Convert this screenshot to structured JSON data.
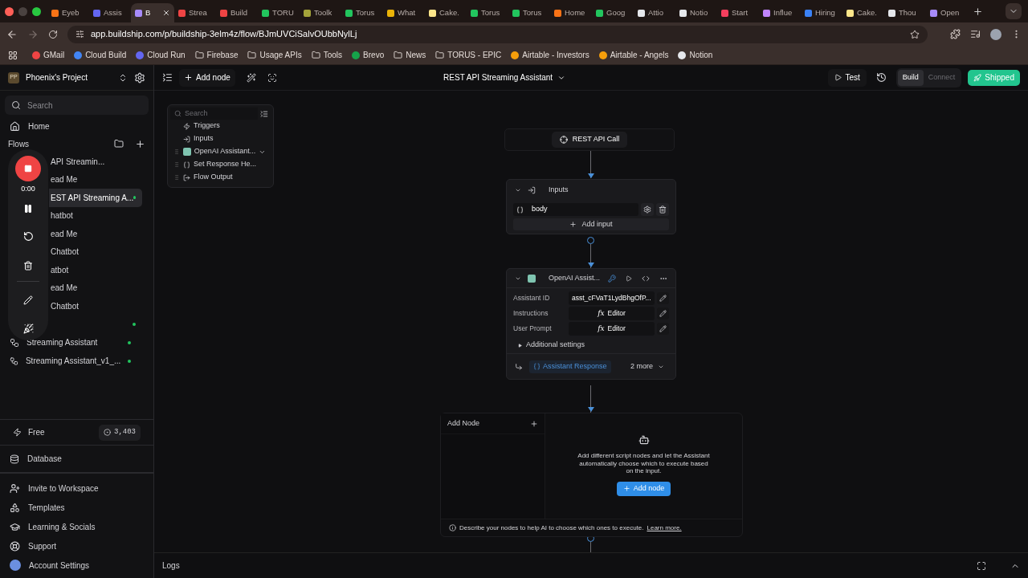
{
  "browser": {
    "tabs": [
      {
        "label": "Eyeb",
        "selected": false,
        "color": "#f97316"
      },
      {
        "label": "Assis",
        "selected": false,
        "color": "#6366f1"
      },
      {
        "label": "B",
        "selected": true,
        "color": "#a78bfa"
      },
      {
        "label": "Strea",
        "selected": false,
        "color": "#ef4444"
      },
      {
        "label": "Build",
        "selected": false,
        "color": "#ef4444"
      },
      {
        "label": "TORU",
        "selected": false,
        "color": "#22c55e"
      },
      {
        "label": "Toolk",
        "selected": false,
        "color": "#a3a33a"
      },
      {
        "label": "Torus",
        "selected": false,
        "color": "#22c55e"
      },
      {
        "label": "What",
        "selected": false,
        "color": "#eab308"
      },
      {
        "label": "Cake.",
        "selected": false,
        "color": "#fde68a"
      },
      {
        "label": "Torus",
        "selected": false,
        "color": "#22c55e"
      },
      {
        "label": "Torus",
        "selected": false,
        "color": "#22c55e"
      },
      {
        "label": "Home",
        "selected": false,
        "color": "#f97316"
      },
      {
        "label": "Goog",
        "selected": false,
        "color": "#22c55e"
      },
      {
        "label": "Attio",
        "selected": false,
        "color": "#e5e7eb"
      },
      {
        "label": "Notio",
        "selected": false,
        "color": "#e5e7eb"
      },
      {
        "label": "Start",
        "selected": false,
        "color": "#f43f5e"
      },
      {
        "label": "Influe",
        "selected": false,
        "color": "#c084fc"
      },
      {
        "label": "Hiring",
        "selected": false,
        "color": "#3b82f6"
      },
      {
        "label": "Cake.",
        "selected": false,
        "color": "#fde68a"
      },
      {
        "label": "Thou",
        "selected": false,
        "color": "#e5e7eb"
      },
      {
        "label": "Open",
        "selected": false,
        "color": "#a78bfa"
      }
    ],
    "url": "app.buildship.com/p/buildship-3elm4z/flow/BJmUVCiSalvOUbbNylLj",
    "bookmarks": [
      {
        "label": "GMail",
        "kind": "site",
        "color": "#ef4444"
      },
      {
        "label": "Cloud Build",
        "kind": "site",
        "color": "#4285f4"
      },
      {
        "label": "Cloud Run",
        "kind": "site",
        "color": "#6366f1"
      },
      {
        "label": "Firebase",
        "kind": "folder"
      },
      {
        "label": "Usage APIs",
        "kind": "folder"
      },
      {
        "label": "Tools",
        "kind": "folder"
      },
      {
        "label": "Brevo",
        "kind": "site",
        "color": "#16a34a"
      },
      {
        "label": "News",
        "kind": "folder"
      },
      {
        "label": "TORUS - EPIC",
        "kind": "folder"
      },
      {
        "label": "Airtable - Investors",
        "kind": "site",
        "color": "#f59e0b"
      },
      {
        "label": "Airtable - Angels",
        "kind": "site",
        "color": "#f59e0b"
      },
      {
        "label": "Notion",
        "kind": "site",
        "color": "#e5e7eb"
      }
    ]
  },
  "sidebar": {
    "project_initials": "PP",
    "project_name": "Phoenix's Project",
    "search_placeholder": "Search",
    "home": "Home",
    "flows_heading": "Flows",
    "flows_behind_recorder": [
      {
        "label": "API Streamin...",
        "selected": false,
        "live": false
      },
      {
        "label": "ead Me",
        "selected": false,
        "live": false
      },
      {
        "label": "EST API Streaming A...",
        "selected": true,
        "live": true
      },
      {
        "label": "hatbot",
        "selected": false,
        "live": false
      },
      {
        "label": "ead Me",
        "selected": false,
        "live": false
      },
      {
        "label": "Chatbot",
        "selected": false,
        "live": false
      },
      {
        "label": "atbot",
        "selected": false,
        "live": false
      },
      {
        "label": "ead Me",
        "selected": false,
        "live": false
      },
      {
        "label": "Chatbot",
        "selected": false,
        "live": false
      },
      {
        "selected": false,
        "live": true
      }
    ],
    "flows": [
      {
        "label": "Streaming Assistant",
        "live": true
      },
      {
        "label": "Streaming Assistant_v1_...",
        "live": true
      }
    ],
    "plan": "Free",
    "credits": "3,403",
    "database": "Database",
    "links": [
      {
        "label": "Invite to Workspace",
        "kind": "invite"
      },
      {
        "label": "Templates",
        "kind": "templates"
      },
      {
        "label": "Learning & Socials",
        "kind": "learning"
      },
      {
        "label": "Support",
        "kind": "support"
      },
      {
        "label": "Account Settings",
        "kind": "account"
      }
    ]
  },
  "recorder": {
    "time": "0:00"
  },
  "toolbar": {
    "add_node": "Add node",
    "flow_title": "REST API Streaming Assistant",
    "test": "Test",
    "modes": [
      {
        "label": "Build",
        "selected": true
      },
      {
        "label": "Connect",
        "selected": false
      }
    ],
    "shipped": "Shipped"
  },
  "node_panel": {
    "search_placeholder": "Search",
    "items": [
      {
        "label": "Triggers",
        "kind": "trigger",
        "expandable": false
      },
      {
        "label": "Inputs",
        "kind": "inputs",
        "expandable": false
      },
      {
        "label": "OpenAI Assistant...",
        "kind": "openai",
        "expandable": true
      },
      {
        "label": "Set Response He...",
        "kind": "object",
        "expandable": false
      },
      {
        "label": "Flow Output",
        "kind": "output",
        "expandable": false
      }
    ]
  },
  "canvas": {
    "trigger": "REST API Call",
    "inputs_node": {
      "title": "Inputs",
      "inputs": [
        "body"
      ],
      "add_input": "Add input"
    },
    "assistant_node": {
      "title": "OpenAI Assist...",
      "fields": [
        {
          "label": "Assistant ID",
          "value": "asst_cFVaT1LydBhgOfP...",
          "kind": "text"
        },
        {
          "label": "Instructions",
          "value": "Editor",
          "kind": "editor",
          "prefix": "fx"
        },
        {
          "label": "User Prompt",
          "value": "Editor",
          "kind": "editor",
          "prefix": "fx"
        }
      ],
      "additional": "Additional settings",
      "output": "Assistant Response",
      "more": "2 more"
    },
    "add_node_panel": {
      "title": "Add Node",
      "message": "Add different script nodes and let the Assistant automatically choose which to execute based on the input.",
      "button": "Add node",
      "hint": "Describe your nodes to help AI to choose which ones to execute.",
      "hint_link": "Learn more."
    }
  },
  "logs": "Logs"
}
